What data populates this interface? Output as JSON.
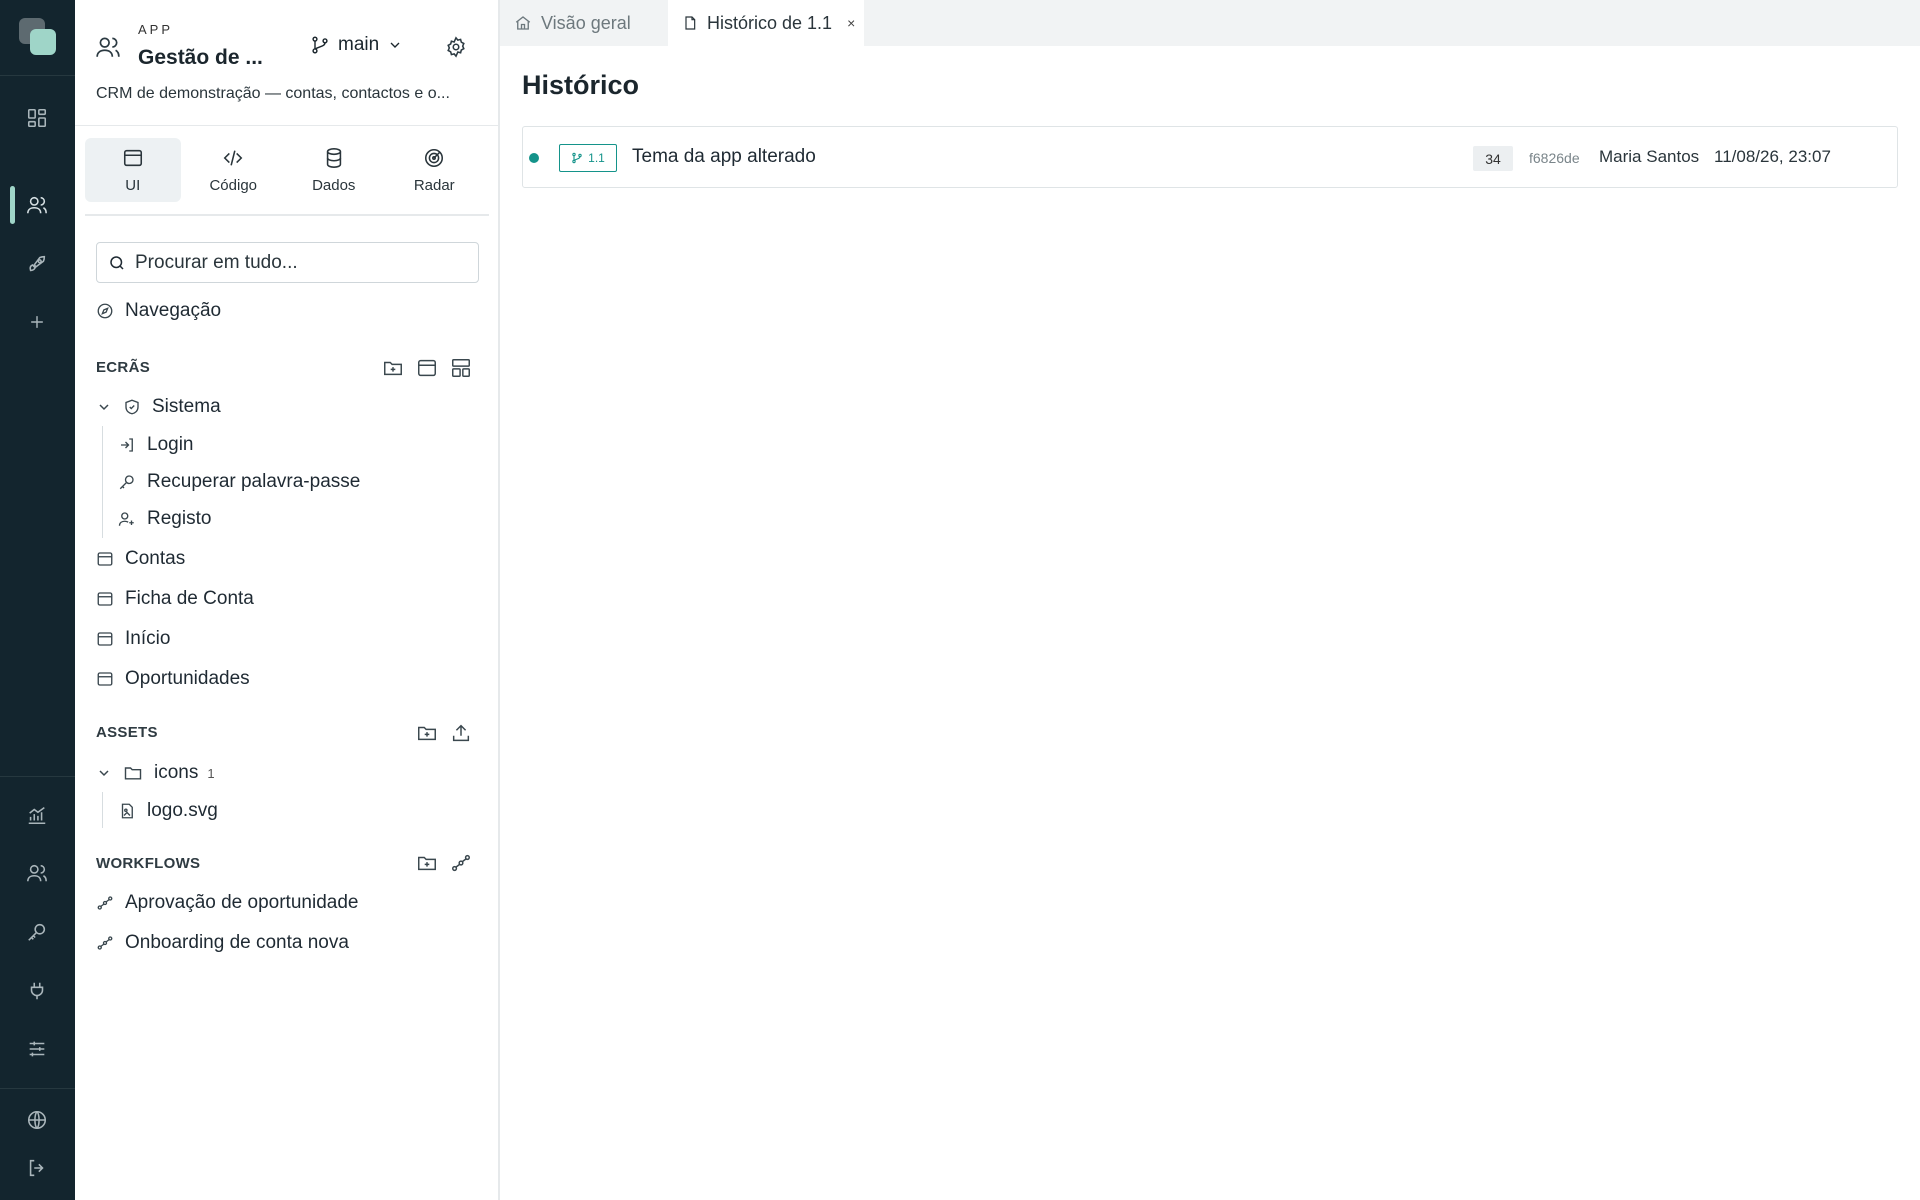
{
  "app": {
    "kicker": "APP",
    "title": "Gestão de ...",
    "branch": "main",
    "description": "CRM de demonstração — contas, contactos e o..."
  },
  "modes": [
    {
      "label": "UI",
      "icon": "browser-window-icon",
      "active": true
    },
    {
      "label": "Código",
      "icon": "code-icon",
      "active": false
    },
    {
      "label": "Dados",
      "icon": "database-icon",
      "active": false
    },
    {
      "label": "Radar",
      "icon": "radar-icon",
      "active": false
    }
  ],
  "search": {
    "placeholder": "Procurar em tudo..."
  },
  "navigation": {
    "label": "Navegação"
  },
  "screens": {
    "heading": "ECRÃS",
    "group": "Sistema",
    "children": [
      "Login",
      "Recuperar palavra-passe",
      "Registo"
    ],
    "items": [
      "Contas",
      "Ficha de Conta",
      "Início",
      "Oportunidades"
    ]
  },
  "assets": {
    "heading": "ASSETS",
    "folder": "icons",
    "folder_count": "1",
    "files": [
      "logo.svg"
    ]
  },
  "workflows": {
    "heading": "WORKFLOWS",
    "items": [
      "Aprovação de oportunidade",
      "Onboarding de conta nova"
    ]
  },
  "tabs": [
    {
      "label": "Visão geral",
      "icon": "home-icon",
      "active": false
    },
    {
      "label": "Histórico de 1.1",
      "icon": "file-icon",
      "active": true,
      "close": "×"
    }
  ],
  "main": {
    "title": "Histórico",
    "history": [
      {
        "version": "1.1",
        "message": "Tema da app alterado",
        "count": "34",
        "hash": "f6826de",
        "author": "Maria Santos",
        "date": "11/08/26, 23:07"
      }
    ]
  },
  "rail": {
    "items": [
      "dashboard-icon",
      "users-icon",
      "rocket-icon",
      "plus-icon",
      "analytics-icon",
      "team-icon",
      "key-icon",
      "plug-icon",
      "sliders-icon",
      "globe-icon",
      "logout-icon"
    ]
  },
  "colors": {
    "rail": "#13252e",
    "accent": "#14938a",
    "accent_soft": "#9fd5c8"
  }
}
